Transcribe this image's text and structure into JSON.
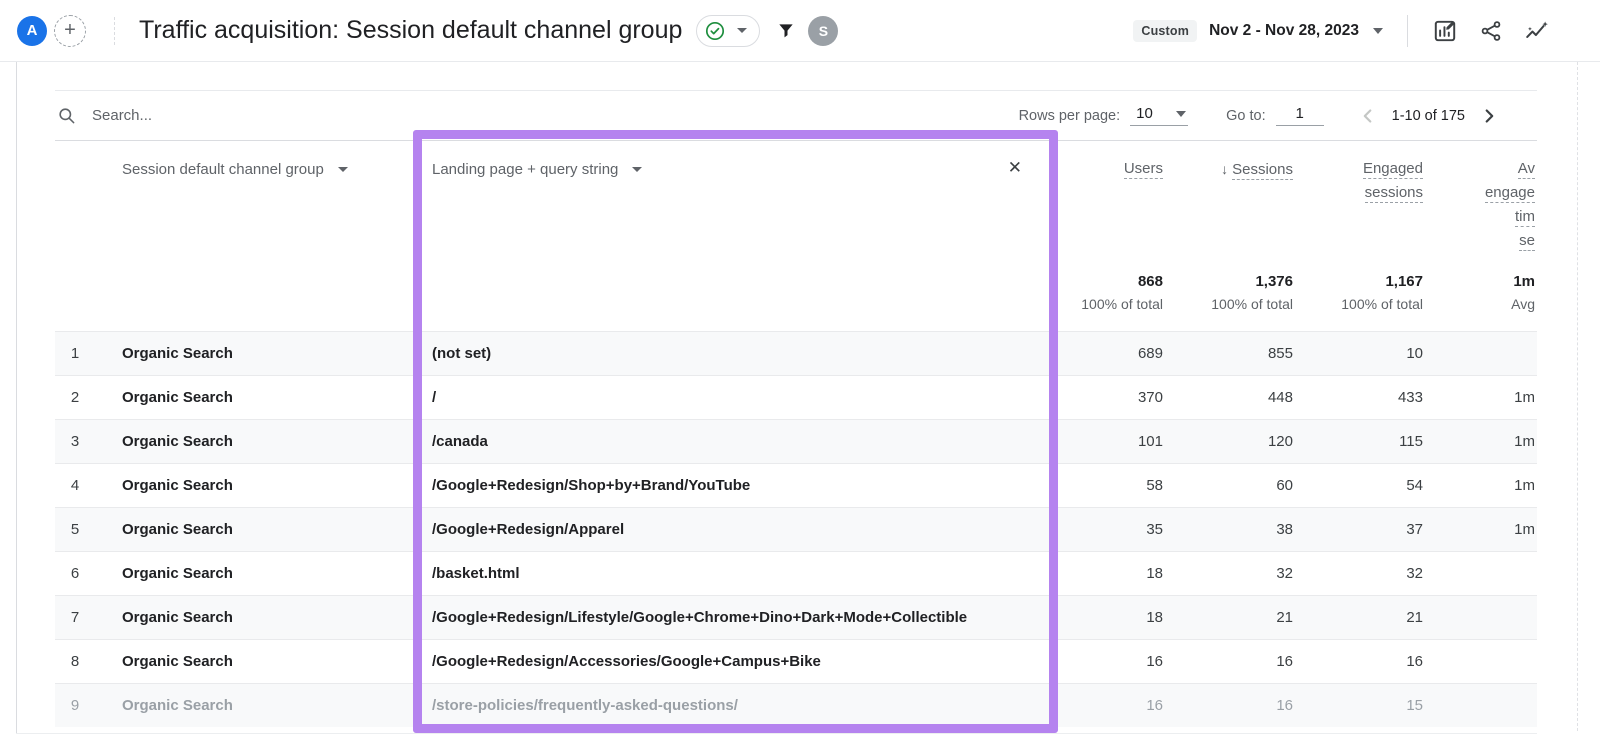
{
  "colors": {
    "accent_purple": "#b583ef",
    "avatar_blue": "#1a73e8",
    "check_green": "#1e8e3e"
  },
  "header": {
    "avatar_initial": "A",
    "title": "Traffic acquisition: Session default channel group",
    "date_preset": "Custom",
    "date_range": "Nov 2 - Nov 28, 2023",
    "collaborator_initial": "S"
  },
  "toolbar": {
    "search_placeholder": "Search...",
    "rows_per_page_label": "Rows per page:",
    "rows_per_page_value": "10",
    "goto_label": "Go to:",
    "goto_value": "1",
    "pagination_text": "1-10 of 175"
  },
  "table": {
    "columns": {
      "dimension_primary": "Session default channel group",
      "dimension_secondary": "Landing page + query string",
      "users": "Users",
      "sessions": "Sessions",
      "engaged_line1": "Engaged",
      "engaged_line2": "sessions",
      "avg_lines": [
        "Av",
        "engage",
        "tim",
        "se"
      ]
    },
    "totals": {
      "users": "868",
      "users_sub": "100% of total",
      "sessions": "1,376",
      "sessions_sub": "100% of total",
      "engaged": "1,167",
      "engaged_sub": "100% of total",
      "avg": "1m",
      "avg_sub": "Avg"
    },
    "rows": [
      {
        "n": "1",
        "channel": "Organic Search",
        "landing": "(not set)",
        "users": "689",
        "sessions": "855",
        "engaged": "10",
        "avg": ""
      },
      {
        "n": "2",
        "channel": "Organic Search",
        "landing": "/",
        "users": "370",
        "sessions": "448",
        "engaged": "433",
        "avg": "1m"
      },
      {
        "n": "3",
        "channel": "Organic Search",
        "landing": "/canada",
        "users": "101",
        "sessions": "120",
        "engaged": "115",
        "avg": "1m"
      },
      {
        "n": "4",
        "channel": "Organic Search",
        "landing": "/Google+Redesign/Shop+by+Brand/YouTube",
        "users": "58",
        "sessions": "60",
        "engaged": "54",
        "avg": "1m"
      },
      {
        "n": "5",
        "channel": "Organic Search",
        "landing": "/Google+Redesign/Apparel",
        "users": "35",
        "sessions": "38",
        "engaged": "37",
        "avg": "1m"
      },
      {
        "n": "6",
        "channel": "Organic Search",
        "landing": "/basket.html",
        "users": "18",
        "sessions": "32",
        "engaged": "32",
        "avg": ""
      },
      {
        "n": "7",
        "channel": "Organic Search",
        "landing": "/Google+Redesign/Lifestyle/Google+Chrome+Dino+Dark+Mode+Collectible",
        "users": "18",
        "sessions": "21",
        "engaged": "21",
        "avg": ""
      },
      {
        "n": "8",
        "channel": "Organic Search",
        "landing": "/Google+Redesign/Accessories/Google+Campus+Bike",
        "users": "16",
        "sessions": "16",
        "engaged": "16",
        "avg": ""
      },
      {
        "n": "9",
        "channel": "Organic Search",
        "landing": "/store-policies/frequently-asked-questions/",
        "users": "16",
        "sessions": "16",
        "engaged": "15",
        "avg": "",
        "faded": true
      }
    ]
  }
}
